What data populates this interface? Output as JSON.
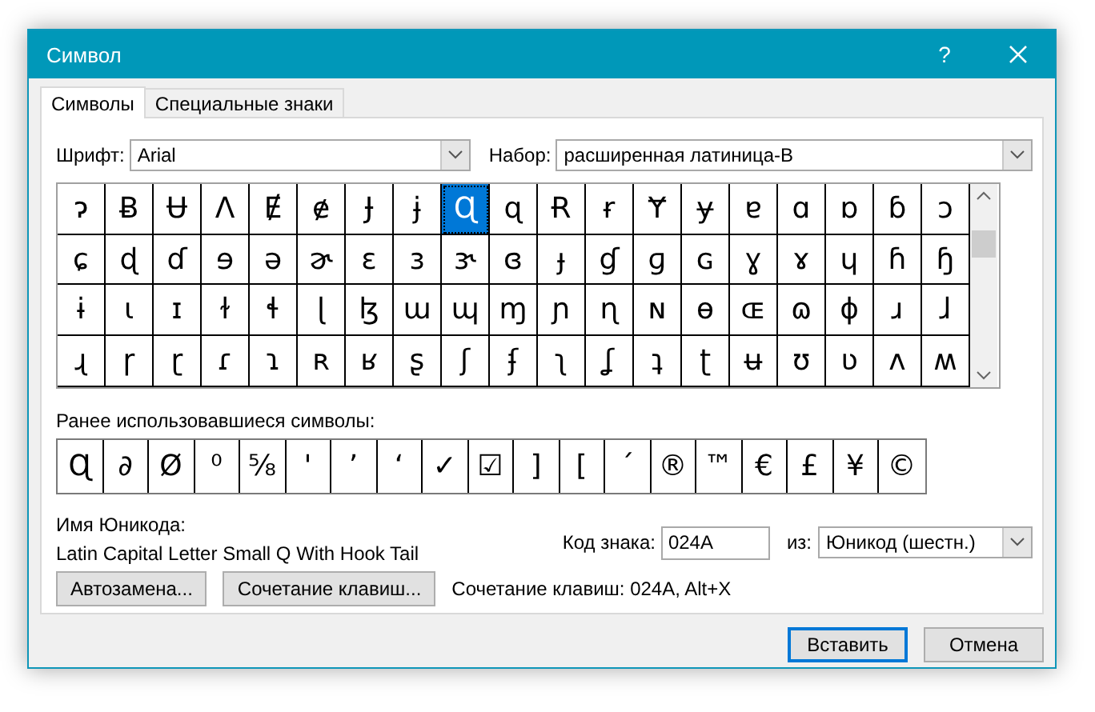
{
  "window": {
    "title": "Символ",
    "help": "?"
  },
  "tabs": [
    {
      "label": "Символы",
      "selected": true
    },
    {
      "label": "Специальные знаки",
      "selected": false
    }
  ],
  "font": {
    "label": "Шрифт:",
    "value": "Arial"
  },
  "subset": {
    "label": "Набор:",
    "value": "расширенная латиница-B"
  },
  "grid": {
    "rows": [
      [
        {
          "char": "ɂ",
          "selected": false
        },
        {
          "char": "Ƀ",
          "selected": false
        },
        {
          "char": "Ʉ",
          "selected": false
        },
        {
          "char": "Ʌ",
          "selected": false
        },
        {
          "char": "Ɇ",
          "selected": false
        },
        {
          "char": "ɇ",
          "selected": false
        },
        {
          "char": "Ɉ",
          "selected": false
        },
        {
          "char": "ɉ",
          "selected": false
        },
        {
          "char": "Ɋ",
          "selected": true
        },
        {
          "char": "ɋ",
          "selected": false
        },
        {
          "char": "Ɍ",
          "selected": false
        },
        {
          "char": "ɍ",
          "selected": false
        },
        {
          "char": "Ɏ",
          "selected": false
        },
        {
          "char": "ɏ",
          "selected": false
        },
        {
          "char": "ɐ",
          "selected": false
        },
        {
          "char": "ɑ",
          "selected": false
        },
        {
          "char": "ɒ",
          "selected": false
        },
        {
          "char": "ɓ",
          "selected": false
        },
        {
          "char": "ɔ",
          "selected": false
        }
      ],
      [
        {
          "char": "ɕ",
          "selected": false
        },
        {
          "char": "ɖ",
          "selected": false
        },
        {
          "char": "ɗ",
          "selected": false
        },
        {
          "char": "ɘ",
          "selected": false
        },
        {
          "char": "ə",
          "selected": false
        },
        {
          "char": "ɚ",
          "selected": false
        },
        {
          "char": "ɛ",
          "selected": false
        },
        {
          "char": "ɜ",
          "selected": false
        },
        {
          "char": "ɝ",
          "selected": false
        },
        {
          "char": "ɞ",
          "selected": false
        },
        {
          "char": "ɟ",
          "selected": false
        },
        {
          "char": "ɠ",
          "selected": false
        },
        {
          "char": "ɡ",
          "selected": false
        },
        {
          "char": "ɢ",
          "selected": false
        },
        {
          "char": "ɣ",
          "selected": false
        },
        {
          "char": "ɤ",
          "selected": false
        },
        {
          "char": "ɥ",
          "selected": false
        },
        {
          "char": "ɦ",
          "selected": false
        },
        {
          "char": "ɧ",
          "selected": false
        }
      ],
      [
        {
          "char": "ɨ",
          "selected": false
        },
        {
          "char": "ɩ",
          "selected": false
        },
        {
          "char": "ɪ",
          "selected": false
        },
        {
          "char": "ɫ",
          "selected": false
        },
        {
          "char": "ɬ",
          "selected": false
        },
        {
          "char": "ɭ",
          "selected": false
        },
        {
          "char": "ɮ",
          "selected": false
        },
        {
          "char": "ɯ",
          "selected": false
        },
        {
          "char": "ɰ",
          "selected": false
        },
        {
          "char": "ɱ",
          "selected": false
        },
        {
          "char": "ɲ",
          "selected": false
        },
        {
          "char": "ɳ",
          "selected": false
        },
        {
          "char": "ɴ",
          "selected": false
        },
        {
          "char": "ɵ",
          "selected": false
        },
        {
          "char": "ɶ",
          "selected": false
        },
        {
          "char": "ɷ",
          "selected": false
        },
        {
          "char": "ɸ",
          "selected": false
        },
        {
          "char": "ɹ",
          "selected": false
        },
        {
          "char": "ɺ",
          "selected": false
        }
      ],
      [
        {
          "char": "ɻ",
          "selected": false
        },
        {
          "char": "ɼ",
          "selected": false
        },
        {
          "char": "ɽ",
          "selected": false
        },
        {
          "char": "ɾ",
          "selected": false
        },
        {
          "char": "ɿ",
          "selected": false
        },
        {
          "char": "ʀ",
          "selected": false
        },
        {
          "char": "ʁ",
          "selected": false
        },
        {
          "char": "ʂ",
          "selected": false
        },
        {
          "char": "ʃ",
          "selected": false
        },
        {
          "char": "ʄ",
          "selected": false
        },
        {
          "char": "ʅ",
          "selected": false
        },
        {
          "char": "ʆ",
          "selected": false
        },
        {
          "char": "ʇ",
          "selected": false
        },
        {
          "char": "ʈ",
          "selected": false
        },
        {
          "char": "ʉ",
          "selected": false
        },
        {
          "char": "ʊ",
          "selected": false
        },
        {
          "char": "ʋ",
          "selected": false
        },
        {
          "char": "ʌ",
          "selected": false
        },
        {
          "char": "ʍ",
          "selected": false
        }
      ]
    ]
  },
  "recent": {
    "label": "Ранее использовавшиеся символы:",
    "symbols": [
      "Ɋ",
      "∂",
      "Ø",
      "⁰",
      "⅝",
      "'",
      "’",
      "‘",
      "✓",
      "☑",
      "]",
      "[",
      "´",
      "®",
      "™",
      "€",
      "£",
      "¥",
      "©"
    ]
  },
  "unicode_name": {
    "label": "Имя Юникода:",
    "value": "Latin Capital Letter Small Q With Hook Tail"
  },
  "char_code": {
    "label": "Код знака:",
    "value": "024A"
  },
  "from": {
    "label": "из:",
    "value": "Юникод (шестн.)"
  },
  "buttons": [
    {
      "label": "Автозамена..."
    },
    {
      "label": "Сочетание клавиш..."
    }
  ],
  "shortcut_text": "Сочетание клавиш: 024A, Alt+X",
  "footer_buttons": [
    {
      "label": "Вставить",
      "default": true
    },
    {
      "label": "Отмена",
      "default": false
    }
  ]
}
